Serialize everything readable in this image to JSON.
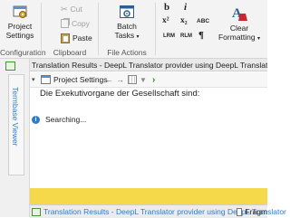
{
  "ribbon": {
    "configuration": {
      "button_line1": "Project",
      "button_line2": "Settings",
      "group_label": "Configuration"
    },
    "clipboard": {
      "cut": "Cut",
      "copy": "Copy",
      "paste": "Paste",
      "group_label": "Clipboard"
    },
    "file_actions": {
      "button_line1": "Batch",
      "button_line2": "Tasks",
      "group_label": "File Actions"
    },
    "formatting": {
      "bold": "b",
      "italic": "i",
      "superscript": "x²",
      "subscript": "x₂",
      "small_caps": "ABC",
      "extra1": "LRM",
      "extra2": "RLM",
      "pilcrow": "¶",
      "clear_line1": "Clear",
      "clear_line2": "Formatting"
    }
  },
  "left_strip": {
    "termbase_viewer": "Termbase Viewer"
  },
  "panel": {
    "title": "Translation Results - DeepL Translator provider using DeepL Translator ,New",
    "toolbar": {
      "project_settings": "Project Settings"
    },
    "source_text": "Die Exekutivorgane der Gesellschaft sind:",
    "status": "Searching..."
  },
  "bottom_tabs": {
    "tab1": "Translation Results - DeepL Translator provider using DeepL Translator",
    "tab2": "Fragm"
  },
  "colors": {
    "accent_blue": "#2f7cc9",
    "yellow_bar": "#f5d94a",
    "clear_red": "#c8272d"
  }
}
